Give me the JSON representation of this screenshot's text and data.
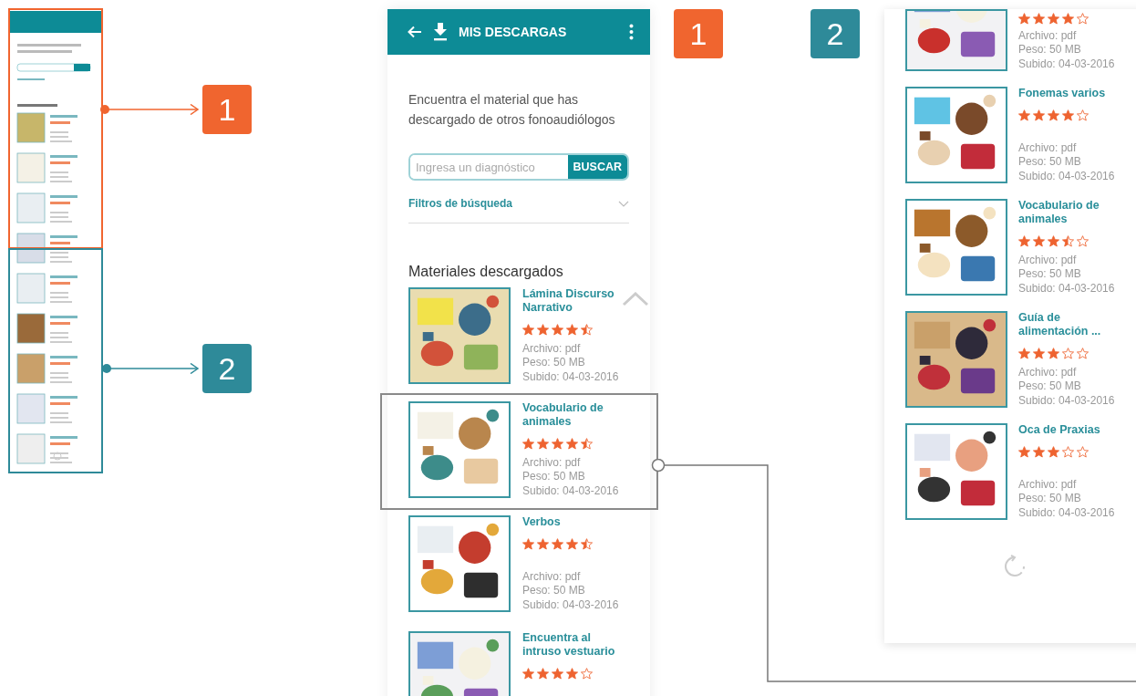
{
  "overview_frames": [
    {
      "color": "#f0652f"
    },
    {
      "color": "#2e8a99"
    }
  ],
  "overview_badges": [
    {
      "label": "1",
      "color": "#f0652f"
    },
    {
      "label": "2",
      "color": "#2e8a99"
    }
  ],
  "panel_badges": [
    {
      "label": "1",
      "color": "#f0652f"
    },
    {
      "label": "2",
      "color": "#2e8a99"
    }
  ],
  "screen_1": {
    "title": "MIS DESCARGAS",
    "intro": "Encuentra el material que has descargado de otros fonoaudiólogos",
    "search": {
      "placeholder": "Ingresa un diagnóstico",
      "button": "BUSCAR"
    },
    "filters": {
      "label": "Filtros de búsqueda",
      "expanded": false
    },
    "section_title": "Materiales descargados",
    "items": [
      {
        "title": "Lámina Discurso Narrativo",
        "stars": 4.5,
        "file": "Archivo: pdf",
        "size": "Peso: 50 MB",
        "uploaded": "Subido: 04-03-2016",
        "highlighted": false
      },
      {
        "title": "Vocabulario de animales",
        "stars": 4.5,
        "file": "Archivo: pdf",
        "size": "Peso: 50 MB",
        "uploaded": "Subido: 04-03-2016",
        "highlighted": true
      },
      {
        "title": "Verbos",
        "stars": 4.5,
        "file": "Archivo: pdf",
        "size": "Peso: 50 MB",
        "uploaded": "Subido: 04-03-2016",
        "highlighted": false
      },
      {
        "title": "Encuentra al intruso vestuario",
        "stars": 4,
        "highlighted": false
      }
    ]
  },
  "screen_2": {
    "items": [
      {
        "stars": 4,
        "file": "Archivo: pdf",
        "size": "Peso: 50 MB",
        "uploaded": "Subido: 04-03-2016"
      },
      {
        "title": "Fonemas varios",
        "stars": 4,
        "file": "Archivo: pdf",
        "size": "Peso: 50 MB",
        "uploaded": "Subido: 04-03-2016"
      },
      {
        "title": "Vocabulario de animales",
        "stars": 3.5,
        "file": "Archivo: pdf",
        "size": "Peso: 50 MB",
        "uploaded": "Subido: 04-03-2016"
      },
      {
        "title": "Guía de alimentación ...",
        "stars": 3,
        "file": "Archivo: pdf",
        "size": "Peso: 50 MB",
        "uploaded": "Subido: 04-03-2016"
      },
      {
        "title": "Oca de Praxias",
        "stars": 3,
        "file": "Archivo: pdf",
        "size": "Peso: 50 MB",
        "uploaded": "Subido: 04-03-2016"
      }
    ]
  }
}
